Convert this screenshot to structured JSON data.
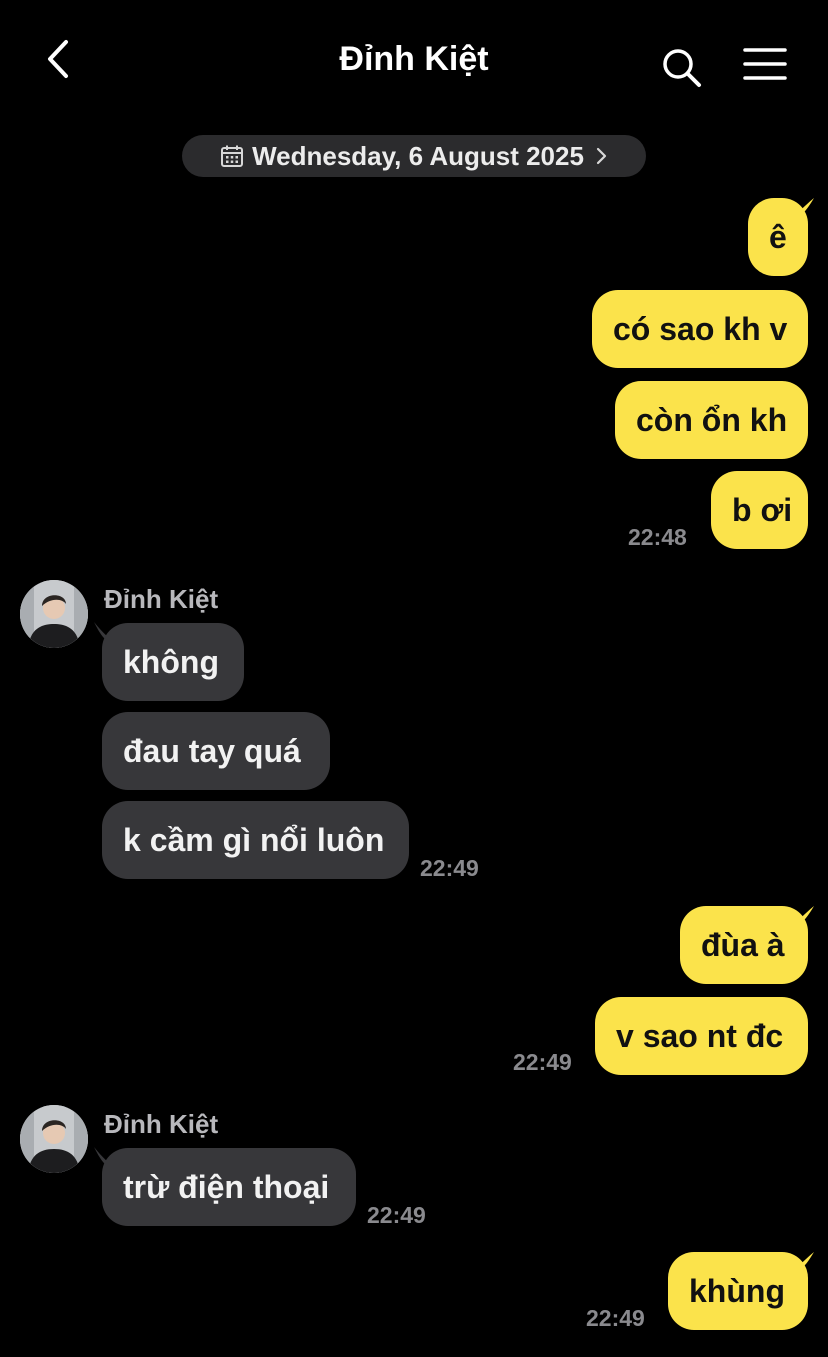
{
  "header": {
    "title": "Đỉnh Kiệt",
    "back_icon": "chevron-left-icon",
    "search_icon": "search-icon",
    "menu_icon": "hamburger-menu-icon"
  },
  "date_divider": {
    "text": "Wednesday, 6 August 2025",
    "icon": "calendar-icon"
  },
  "contact": {
    "name": "Đỉnh Kiệt"
  },
  "colors": {
    "outgoing_bubble": "#fbe34b",
    "incoming_bubble": "#37373a",
    "background": "#000000",
    "timestamp": "#8a8a8e"
  },
  "messages": [
    {
      "dir": "out",
      "text": "ê"
    },
    {
      "dir": "out",
      "text": "có sao kh v"
    },
    {
      "dir": "out",
      "text": "còn ổn kh"
    },
    {
      "dir": "out",
      "text": "b ơi",
      "time": "22:48"
    },
    {
      "dir": "in",
      "text": "không",
      "sender": "Đỉnh Kiệt"
    },
    {
      "dir": "in",
      "text": "đau tay quá"
    },
    {
      "dir": "in",
      "text": "k cầm gì nổi luôn",
      "time": "22:49"
    },
    {
      "dir": "out",
      "text": "đùa à"
    },
    {
      "dir": "out",
      "text": "v sao nt đc",
      "time": "22:49"
    },
    {
      "dir": "in",
      "text": "trừ điện thoại",
      "sender": "Đỉnh Kiệt",
      "time": "22:49"
    },
    {
      "dir": "out",
      "text": "khùng",
      "time": "22:49"
    }
  ]
}
